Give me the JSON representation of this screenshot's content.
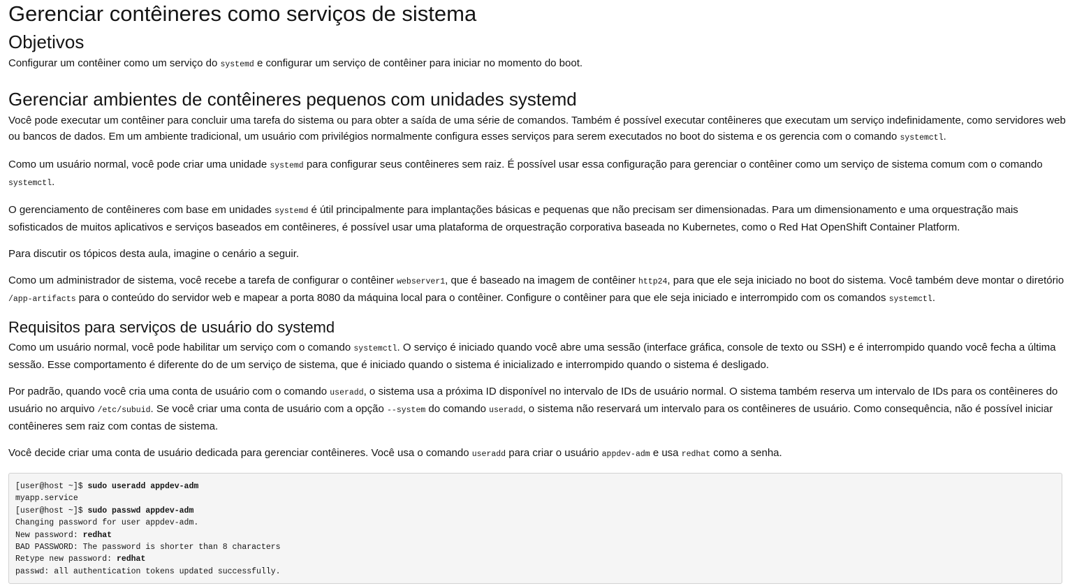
{
  "title": "Gerenciar contêineres como serviços de sistema",
  "objectives": {
    "heading": "Objetivos",
    "p1": [
      "Configurar um contêiner como um serviço do ",
      "systemd",
      " e configurar um serviço de contêiner para iniciar no momento do boot."
    ]
  },
  "section1": {
    "heading": "Gerenciar ambientes de contêineres pequenos com unidades systemd",
    "p1": [
      "Você pode executar um contêiner para concluir uma tarefa do sistema ou para obter a saída de uma série de comandos. Também é possível executar contêineres que executam um serviço indefinidamente, como servidores web ou bancos de dados. Em um ambiente tradicional, um usuário com privilégios normalmente configura esses serviços para serem executados no boot do sistema e os gerencia com o comando ",
      "systemctl",
      "."
    ],
    "p2": [
      "Como um usuário normal, você pode criar uma unidade ",
      "systemd",
      " para configurar seus contêineres sem raiz. É possível usar essa configuração para gerenciar o contêiner como um serviço de sistema comum com o comando ",
      "systemctl",
      "."
    ],
    "p3": [
      "O gerenciamento de contêineres com base em unidades ",
      "systemd",
      " é útil principalmente para implantações básicas e pequenas que não precisam ser dimensionadas. Para um dimensionamento e uma orquestração mais sofisticados de muitos aplicativos e serviços baseados em contêineres, é possível usar uma plataforma de orquestração corporativa baseada no Kubernetes, como o Red Hat OpenShift Container Platform."
    ],
    "p4": [
      "Para discutir os tópicos desta aula, imagine o cenário a seguir."
    ],
    "p5": [
      "Como um administrador de sistema, você recebe a tarefa de configurar o contêiner ",
      "webserver1",
      ", que é baseado na imagem de contêiner ",
      "http24",
      ", para que ele seja iniciado no boot do sistema. Você também deve montar o diretório ",
      "/app-artifacts",
      " para o conteúdo do servidor web e mapear a porta 8080 da máquina local para o contêiner. Configure o contêiner para que ele seja iniciado e interrompido com os comandos ",
      "systemctl",
      "."
    ]
  },
  "section2": {
    "heading": "Requisitos para serviços de usuário do systemd",
    "p1": [
      "Como um usuário normal, você pode habilitar um serviço com o comando ",
      "systemctl",
      ". O serviço é iniciado quando você abre uma sessão (interface gráfica, console de texto ou SSH) e é interrompido quando você fecha a última sessão. Esse comportamento é diferente do de um serviço de sistema, que é iniciado quando o sistema é inicializado e interrompido quando o sistema é desligado."
    ],
    "p2": [
      "Por padrão, quando você cria uma conta de usuário com o comando ",
      "useradd",
      ", o sistema usa a próxima ID disponível no intervalo de IDs de usuário normal. O sistema também reserva um intervalo de IDs para os contêineres do usuário no arquivo ",
      "/etc/subuid",
      ". Se você criar uma conta de usuário com a opção ",
      "--system",
      " do comando ",
      "useradd",
      ", o sistema não reservará um intervalo para os contêineres de usuário. Como consequência, não é possível iniciar contêineres sem raiz com contas de sistema."
    ],
    "p3": [
      "Você decide criar uma conta de usuário dedicada para gerenciar contêineres. Você usa o comando ",
      "useradd",
      " para criar o usuário ",
      "appdev-adm",
      " e usa ",
      "redhat",
      " como a senha."
    ]
  },
  "terminal": [
    [
      "[user@host ~]$ ",
      "sudo useradd appdev-adm"
    ],
    [
      "myapp.service",
      ""
    ],
    [
      "[user@host ~]$ ",
      "sudo passwd appdev-adm"
    ],
    [
      "Changing password for user appdev-adm.",
      ""
    ],
    [
      "New password: ",
      "redhat"
    ],
    [
      "BAD PASSWORD: The password is shorter than 8 characters",
      ""
    ],
    [
      "Retype new password: ",
      "redhat"
    ],
    [
      "passwd: all authentication tokens updated successfully.",
      ""
    ]
  ]
}
